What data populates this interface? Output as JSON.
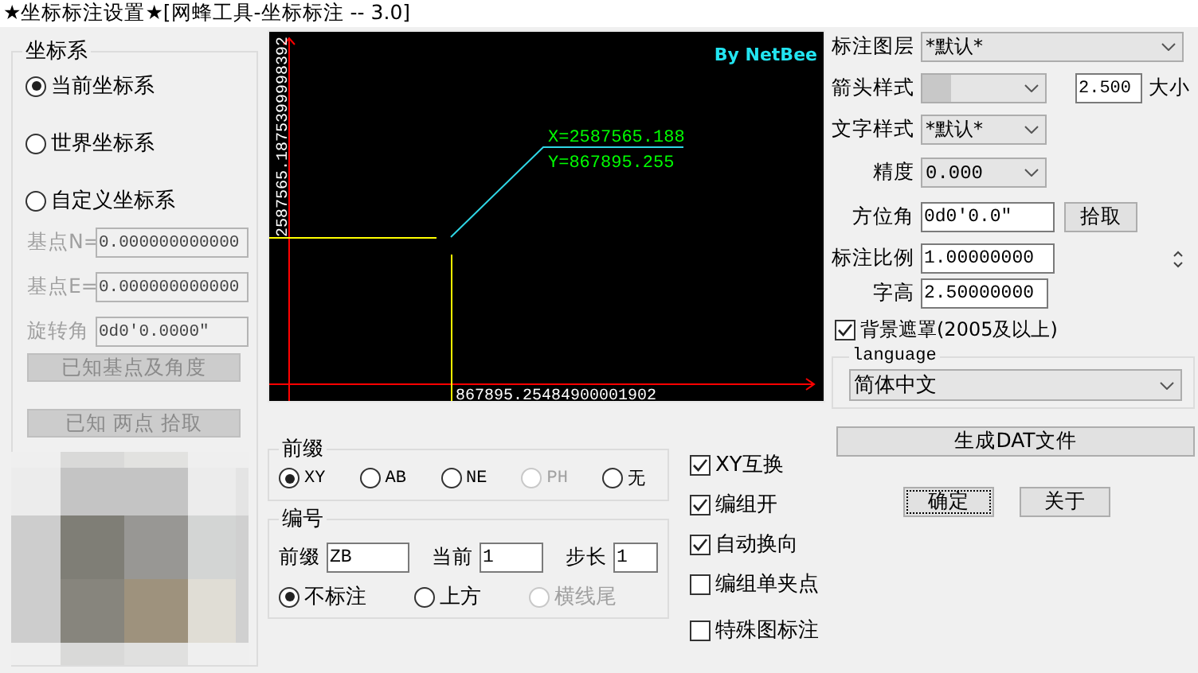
{
  "window": {
    "title": "★坐标标注设置★[网蜂工具-坐标标注 -- 3.0]"
  },
  "coordinate_system": {
    "title": "坐标系",
    "options": [
      {
        "label": "当前坐标系",
        "selected": true
      },
      {
        "label": "世界坐标系",
        "selected": false
      },
      {
        "label": "自定义坐标系",
        "selected": false
      }
    ],
    "fields": [
      {
        "label": "基点N=",
        "value": "0.000000000000",
        "disabled": true
      },
      {
        "label": "基点E=",
        "value": "0.000000000000",
        "disabled": true
      },
      {
        "label": "旋转角",
        "value": "0d0′0.0000″",
        "disabled": true
      }
    ],
    "buttons": [
      {
        "label": "已知基点及角度",
        "disabled": true
      },
      {
        "label": "已知 两点 拾取",
        "disabled": true
      }
    ]
  },
  "preview": {
    "badge": "By NetBee",
    "label_x": "X=2587565.188",
    "label_y": "Y=867895.255",
    "y_axis_value": "2587565.1875399998392",
    "x_axis_value": "867895.25484900001902"
  },
  "prefix": {
    "title": "前缀",
    "options": [
      {
        "label": "XY",
        "selected": true,
        "disabled": false
      },
      {
        "label": "AB",
        "selected": false,
        "disabled": false
      },
      {
        "label": "NE",
        "selected": false,
        "disabled": false
      },
      {
        "label": "PH",
        "selected": false,
        "disabled": true
      },
      {
        "label": "无",
        "selected": false,
        "disabled": false
      }
    ]
  },
  "numbering": {
    "title": "编号",
    "fields": [
      {
        "label": "前缀",
        "value": "ZB"
      },
      {
        "label": "当前",
        "value": "1"
      },
      {
        "label": "步长",
        "value": "1"
      }
    ],
    "options": [
      {
        "label": "不标注",
        "selected": true,
        "disabled": false
      },
      {
        "label": "上方",
        "selected": false,
        "disabled": false
      },
      {
        "label": "横线尾",
        "selected": false,
        "disabled": true
      }
    ]
  },
  "checks": [
    {
      "label": "XY互换",
      "checked": true
    },
    {
      "label": "编组开",
      "checked": true
    },
    {
      "label": "自动换向",
      "checked": true
    },
    {
      "label": "编组单夹点",
      "checked": false
    },
    {
      "label": "特殊图标注",
      "checked": false
    }
  ],
  "settings": {
    "layer": {
      "label": "标注图层",
      "value": "*默认*"
    },
    "arrow_style": {
      "label": "箭头样式",
      "size_value": "2.500",
      "size_label": "大小"
    },
    "text_style": {
      "label": "文字样式",
      "value": "*默认*"
    },
    "precision": {
      "label": "精度",
      "value": "0.000"
    },
    "azimuth": {
      "label": "方位角",
      "value": "0d0′0.0″",
      "button": "拾取"
    },
    "scale": {
      "label": "标注比例",
      "value": "1.00000000"
    },
    "text_height": {
      "label": "字高",
      "value": "2.50000000"
    },
    "background_mask": {
      "label": "背景遮罩(2005及以上)",
      "checked": true
    }
  },
  "language": {
    "title": "language",
    "value": "简体中文"
  },
  "buttons": [
    {
      "label": "生成DAT文件",
      "kind": "wide",
      "focused": false
    },
    {
      "label": "确定",
      "kind": "small",
      "focused": true
    },
    {
      "label": "关于",
      "kind": "small",
      "focused": false
    }
  ]
}
